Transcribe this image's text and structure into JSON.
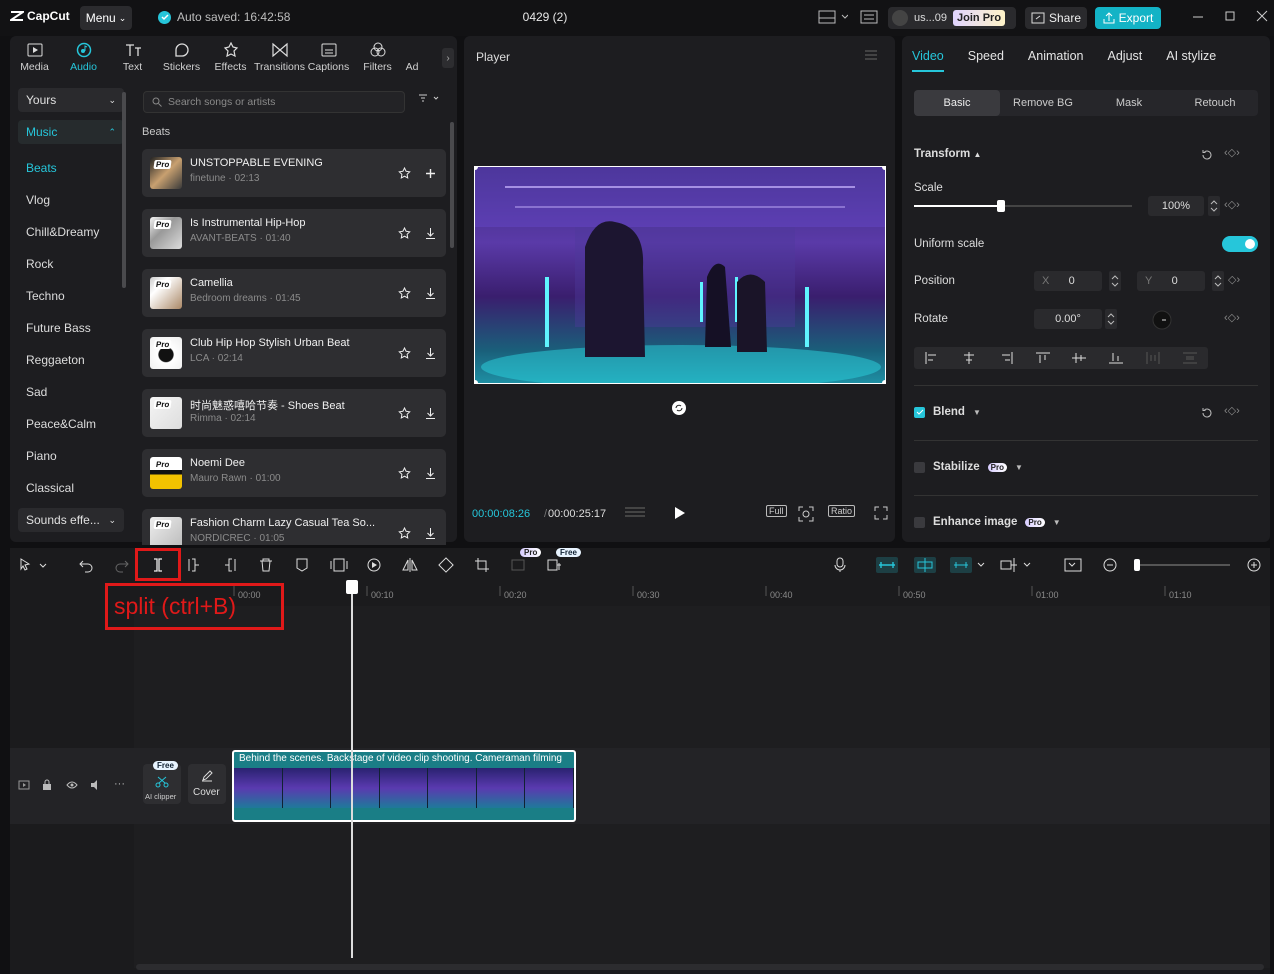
{
  "app": {
    "logo": "CapCut",
    "menu": "Menu",
    "autosave": "Auto saved: 16:42:58",
    "project": "0429 (2)"
  },
  "user": {
    "name": "us...09",
    "join_pro": "Join Pro"
  },
  "header": {
    "share": "Share",
    "export": "Export"
  },
  "left_tabs": [
    {
      "label": "Media"
    },
    {
      "label": "Audio"
    },
    {
      "label": "Text"
    },
    {
      "label": "Stickers"
    },
    {
      "label": "Effects"
    },
    {
      "label": "Transitions"
    },
    {
      "label": "Captions"
    },
    {
      "label": "Filters"
    },
    {
      "label": "Ad"
    }
  ],
  "categories": {
    "yours": "Yours",
    "music": "Music",
    "items": [
      "Beats",
      "Vlog",
      "Chill&Dreamy",
      "Rock",
      "Techno",
      "Future Bass",
      "Reggaeton",
      "Sad",
      "Peace&Calm",
      "Piano",
      "Classical"
    ],
    "sounds": "Sounds effe..."
  },
  "search": {
    "placeholder": "Search songs or artists"
  },
  "beats_header": "Beats",
  "songs": [
    {
      "title": "UNSTOPPABLE EVENING",
      "meta": "finetune · 02:13",
      "action": "+"
    },
    {
      "title": "Is Instrumental Hip-Hop",
      "meta": "AVANT-BEATS · 01:40",
      "action": "download"
    },
    {
      "title": "Camellia",
      "meta": "Bedroom dreams · 01:45",
      "action": "download"
    },
    {
      "title": "Club Hip Hop Stylish Urban Beat",
      "meta": "LCA · 02:14",
      "action": "download"
    },
    {
      "title": "时尚魅惑嘻哈节奏 - Shoes Beat",
      "meta": "Rimma · 02:14",
      "action": "download"
    },
    {
      "title": "Noemi Dee",
      "meta": "Mauro Rawn · 01:00",
      "action": "download"
    },
    {
      "title": "Fashion Charm Lazy Casual Tea So...",
      "meta": "NORDICREC · 01:05",
      "action": "download"
    }
  ],
  "pro_label": "Pro",
  "player": {
    "title": "Player",
    "current": "00:00:08:26",
    "sep": "/",
    "total": "00:00:25:17",
    "full": "Full",
    "ratio": "Ratio"
  },
  "right_tabs": [
    "Video",
    "Speed",
    "Animation",
    "Adjust",
    "AI stylize"
  ],
  "sub_tabs": [
    "Basic",
    "Remove BG",
    "Mask",
    "Retouch"
  ],
  "props": {
    "transform": "Transform",
    "scale": "Scale",
    "scale_value": "100%",
    "scale_fraction": 0.4,
    "uniform_scale": "Uniform scale",
    "position": "Position",
    "pos_x_label": "X",
    "pos_x": "0",
    "pos_y_label": "Y",
    "pos_y": "0",
    "rotate": "Rotate",
    "rotate_value": "0.00°",
    "blend": "Blend",
    "stabilize": "Stabilize",
    "enhance": "Enhance image"
  },
  "timeline": {
    "badges": {
      "pro": "Pro",
      "free": "Free"
    },
    "ticks": [
      "00:00",
      "00:10",
      "00:20",
      "00:30",
      "00:40",
      "00:50",
      "01:00",
      "01:10"
    ],
    "clip_label": "Behind the scenes. Backstage of video clip shooting. Cameraman filming",
    "ai_clipper": "AI clipper",
    "ai_free": "Free",
    "cover": "Cover"
  },
  "annotation": {
    "text": "split (ctrl+B)",
    "color": "#e01919"
  },
  "colors": {
    "accent": "#26c6da"
  }
}
